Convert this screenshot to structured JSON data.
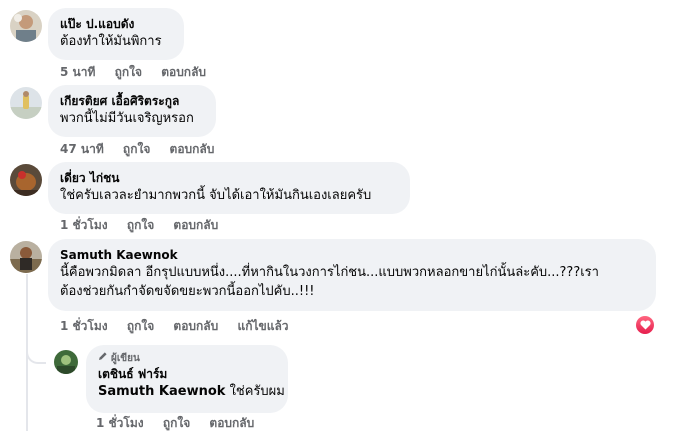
{
  "comments": [
    {
      "name": "แป๊ะ ป.แอบดัง",
      "text": "ต้องทำให้มันพิการ",
      "time": "5 นาที",
      "like": "ถูกใจ",
      "reply": "ตอบกลับ"
    },
    {
      "name": "เกียรติยศ เอื้อศิริตระกูล",
      "text": "พวกนี้ไม่มีวันเจริญหรอก",
      "time": "47 นาที",
      "like": "ถูกใจ",
      "reply": "ตอบกลับ"
    },
    {
      "name": "เดี่ยว ไก่ชน",
      "text": "ใช่ครับเลวละยำมากพวกนี้ จับได้เอาให้มันกินเองเลยครับ",
      "time": "1 ชั่วโมง",
      "like": "ถูกใจ",
      "reply": "ตอบกลับ"
    },
    {
      "name": "Samuth Kaewnok",
      "text_line1": "นี้คือพวกมิดลา อีกรุปแบบหนึ่ง....ที่หากินในวงการไก่ชน...แบบพวกหลอกขายไก่นั้นล่ะคับ...???เรา",
      "text_line2": "ต้องช่วยกันกำจัดขจัดขยะพวกนี้ออกไปคับ..!!!",
      "time": "1 ชั่วโมง",
      "like": "ถูกใจ",
      "reply": "ตอบกลับ",
      "edit": "แก้ไขแล้ว",
      "reaction_icon": "heart-icon"
    }
  ],
  "reply": {
    "badge": "ผู้เขียน",
    "badge_icon": "pencil-icon",
    "name": "เตชินธ์ ฟาร์ม",
    "mention": "Samuth Kaewnok",
    "text": "ใช่ครับผม",
    "time": "1 ชั่วโมง",
    "like": "ถูกใจ",
    "reply": "ตอบกลับ"
  },
  "colors": {
    "bubble": "#f0f2f5",
    "meta": "#65676b",
    "heart": "#e61e4d"
  }
}
